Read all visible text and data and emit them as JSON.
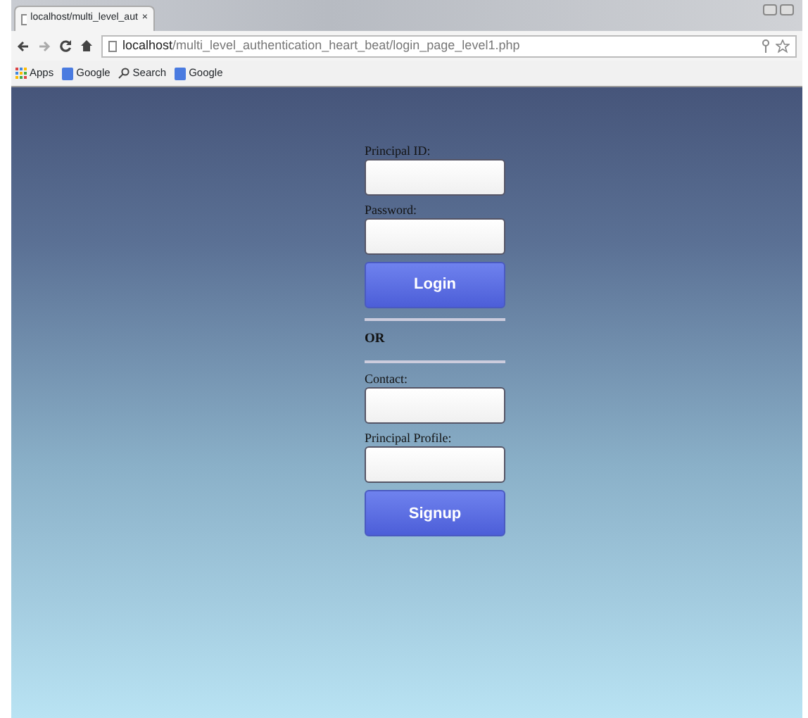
{
  "browser": {
    "tab": {
      "title": "localhost/multi_level_aut",
      "close": "×"
    },
    "url": {
      "host": "localhost",
      "path": "/multi_level_authentication_heart_beat/login_page_level1.php"
    },
    "bookmarks": [
      {
        "kind": "apps",
        "label": "Apps"
      },
      {
        "kind": "google",
        "label": "Google"
      },
      {
        "kind": "search",
        "label": "Search"
      },
      {
        "kind": "google",
        "label": "Google"
      }
    ]
  },
  "form": [
    {
      "kind": "field",
      "label": "Principal ID:"
    },
    {
      "kind": "field",
      "label": "Password:"
    },
    {
      "kind": "button",
      "label": "Login"
    },
    {
      "kind": "divider"
    },
    {
      "kind": "text",
      "label": "OR"
    },
    {
      "kind": "divider"
    },
    {
      "kind": "field",
      "label": "Contact:"
    },
    {
      "kind": "field",
      "label": "Principal Profile:"
    },
    {
      "kind": "button",
      "label": "Signup"
    }
  ]
}
